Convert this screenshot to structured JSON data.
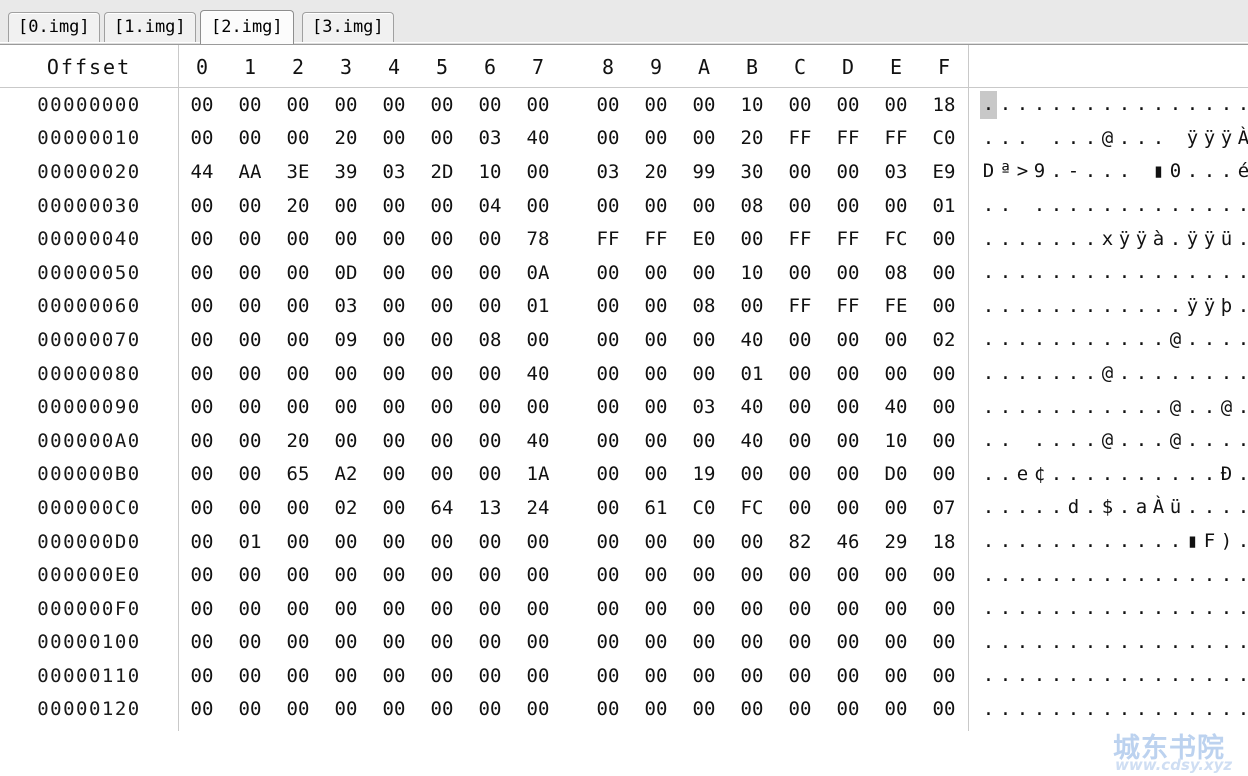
{
  "window": {
    "title": "Hex Editor",
    "background_color": "#ffffff",
    "chrome_color": "#e9e9e9"
  },
  "tabs": {
    "active_index": 2,
    "items": [
      {
        "label": "[0.img]",
        "active": false
      },
      {
        "label": "[1.img]",
        "active": false
      },
      {
        "label": "[2.img]",
        "active": true
      },
      {
        "label": "[3.img]",
        "active": false
      }
    ]
  },
  "header": {
    "offset_label": "Offset",
    "columns": [
      "0",
      "1",
      "2",
      "3",
      "4",
      "5",
      "6",
      "7",
      "8",
      "9",
      "A",
      "B",
      "C",
      "D",
      "E",
      "F"
    ]
  },
  "selection": {
    "row_index": 0,
    "ascii_char_index": 0,
    "highlight_color": "#c8c8c8"
  },
  "watermark": {
    "text_cn": "城东书院",
    "text_url": "www.cdsy.xyz",
    "color_cn": "#bcd2ef",
    "color_url": "#cfdef3"
  },
  "hex_rows": [
    {
      "offset": "00000000",
      "bytes": [
        "00",
        "00",
        "00",
        "00",
        "00",
        "00",
        "00",
        "00",
        "00",
        "00",
        "00",
        "10",
        "00",
        "00",
        "00",
        "18"
      ],
      "ascii": [
        ".",
        ".",
        ".",
        ".",
        ".",
        ".",
        ".",
        ".",
        ".",
        ".",
        ".",
        ".",
        ".",
        ".",
        ".",
        "."
      ]
    },
    {
      "offset": "00000010",
      "bytes": [
        "00",
        "00",
        "00",
        "20",
        "00",
        "00",
        "03",
        "40",
        "00",
        "00",
        "00",
        "20",
        "FF",
        "FF",
        "FF",
        "C0"
      ],
      "ascii": [
        ".",
        ".",
        ".",
        ":sp:",
        ".",
        ".",
        ".",
        "@",
        ".",
        ".",
        ".",
        ":sp:",
        "ÿ",
        "ÿ",
        "ÿ",
        "À"
      ]
    },
    {
      "offset": "00000020",
      "bytes": [
        "44",
        "AA",
        "3E",
        "39",
        "03",
        "2D",
        "10",
        "00",
        "03",
        "20",
        "99",
        "30",
        "00",
        "00",
        "03",
        "E9"
      ],
      "ascii": [
        "D",
        "ª",
        ">",
        "9",
        ".",
        "-",
        ".",
        ".",
        ".",
        ":sp:",
        "▮",
        "0",
        ".",
        ".",
        ".",
        "é"
      ]
    },
    {
      "offset": "00000030",
      "bytes": [
        "00",
        "00",
        "20",
        "00",
        "00",
        "00",
        "04",
        "00",
        "00",
        "00",
        "00",
        "08",
        "00",
        "00",
        "00",
        "01"
      ],
      "ascii": [
        ".",
        ".",
        ":sp:",
        ".",
        ".",
        ".",
        ".",
        ".",
        ".",
        ".",
        ".",
        ".",
        ".",
        ".",
        ".",
        "."
      ]
    },
    {
      "offset": "00000040",
      "bytes": [
        "00",
        "00",
        "00",
        "00",
        "00",
        "00",
        "00",
        "78",
        "FF",
        "FF",
        "E0",
        "00",
        "FF",
        "FF",
        "FC",
        "00"
      ],
      "ascii": [
        ".",
        ".",
        ".",
        ".",
        ".",
        ".",
        ".",
        "x",
        "ÿ",
        "ÿ",
        "à",
        ".",
        "ÿ",
        "ÿ",
        "ü",
        "."
      ]
    },
    {
      "offset": "00000050",
      "bytes": [
        "00",
        "00",
        "00",
        "0D",
        "00",
        "00",
        "00",
        "0A",
        "00",
        "00",
        "00",
        "10",
        "00",
        "00",
        "08",
        "00"
      ],
      "ascii": [
        ".",
        ".",
        ".",
        ".",
        ".",
        ".",
        ".",
        ".",
        ".",
        ".",
        ".",
        ".",
        ".",
        ".",
        ".",
        "."
      ]
    },
    {
      "offset": "00000060",
      "bytes": [
        "00",
        "00",
        "00",
        "03",
        "00",
        "00",
        "00",
        "01",
        "00",
        "00",
        "08",
        "00",
        "FF",
        "FF",
        "FE",
        "00"
      ],
      "ascii": [
        ".",
        ".",
        ".",
        ".",
        ".",
        ".",
        ".",
        ".",
        ".",
        ".",
        ".",
        ".",
        "ÿ",
        "ÿ",
        "þ",
        "."
      ]
    },
    {
      "offset": "00000070",
      "bytes": [
        "00",
        "00",
        "00",
        "09",
        "00",
        "00",
        "08",
        "00",
        "00",
        "00",
        "00",
        "40",
        "00",
        "00",
        "00",
        "02"
      ],
      "ascii": [
        ".",
        ".",
        ".",
        ".",
        ".",
        ".",
        ".",
        ".",
        ".",
        ".",
        ".",
        "@",
        ".",
        ".",
        ".",
        "."
      ]
    },
    {
      "offset": "00000080",
      "bytes": [
        "00",
        "00",
        "00",
        "00",
        "00",
        "00",
        "00",
        "40",
        "00",
        "00",
        "00",
        "01",
        "00",
        "00",
        "00",
        "00"
      ],
      "ascii": [
        ".",
        ".",
        ".",
        ".",
        ".",
        ".",
        ".",
        "@",
        ".",
        ".",
        ".",
        ".",
        ".",
        ".",
        ".",
        "."
      ]
    },
    {
      "offset": "00000090",
      "bytes": [
        "00",
        "00",
        "00",
        "00",
        "00",
        "00",
        "00",
        "00",
        "00",
        "00",
        "03",
        "40",
        "00",
        "00",
        "40",
        "00"
      ],
      "ascii": [
        ".",
        ".",
        ".",
        ".",
        ".",
        ".",
        ".",
        ".",
        ".",
        ".",
        ".",
        "@",
        ".",
        ".",
        "@",
        "."
      ]
    },
    {
      "offset": "000000A0",
      "bytes": [
        "00",
        "00",
        "20",
        "00",
        "00",
        "00",
        "00",
        "40",
        "00",
        "00",
        "00",
        "40",
        "00",
        "00",
        "10",
        "00"
      ],
      "ascii": [
        ".",
        ".",
        ":sp:",
        ".",
        ".",
        ".",
        ".",
        "@",
        ".",
        ".",
        ".",
        "@",
        ".",
        ".",
        ".",
        "."
      ]
    },
    {
      "offset": "000000B0",
      "bytes": [
        "00",
        "00",
        "65",
        "A2",
        "00",
        "00",
        "00",
        "1A",
        "00",
        "00",
        "19",
        "00",
        "00",
        "00",
        "D0",
        "00"
      ],
      "ascii": [
        ".",
        ".",
        "e",
        "¢",
        ".",
        ".",
        ".",
        ".",
        ".",
        ".",
        ".",
        ".",
        ".",
        ".",
        "Ð",
        "."
      ]
    },
    {
      "offset": "000000C0",
      "bytes": [
        "00",
        "00",
        "00",
        "02",
        "00",
        "64",
        "13",
        "24",
        "00",
        "61",
        "C0",
        "FC",
        "00",
        "00",
        "00",
        "07"
      ],
      "ascii": [
        ".",
        ".",
        ".",
        ".",
        ".",
        "d",
        ".",
        "$",
        ".",
        "a",
        "À",
        "ü",
        ".",
        ".",
        ".",
        "."
      ]
    },
    {
      "offset": "000000D0",
      "bytes": [
        "00",
        "01",
        "00",
        "00",
        "00",
        "00",
        "00",
        "00",
        "00",
        "00",
        "00",
        "00",
        "82",
        "46",
        "29",
        "18"
      ],
      "ascii": [
        ".",
        ".",
        ".",
        ".",
        ".",
        ".",
        ".",
        ".",
        ".",
        ".",
        ".",
        ".",
        "▮",
        "F",
        ")",
        "."
      ]
    },
    {
      "offset": "000000E0",
      "bytes": [
        "00",
        "00",
        "00",
        "00",
        "00",
        "00",
        "00",
        "00",
        "00",
        "00",
        "00",
        "00",
        "00",
        "00",
        "00",
        "00"
      ],
      "ascii": [
        ".",
        ".",
        ".",
        ".",
        ".",
        ".",
        ".",
        ".",
        ".",
        ".",
        ".",
        ".",
        ".",
        ".",
        ".",
        "."
      ]
    },
    {
      "offset": "000000F0",
      "bytes": [
        "00",
        "00",
        "00",
        "00",
        "00",
        "00",
        "00",
        "00",
        "00",
        "00",
        "00",
        "00",
        "00",
        "00",
        "00",
        "00"
      ],
      "ascii": [
        ".",
        ".",
        ".",
        ".",
        ".",
        ".",
        ".",
        ".",
        ".",
        ".",
        ".",
        ".",
        ".",
        ".",
        ".",
        "."
      ]
    },
    {
      "offset": "00000100",
      "bytes": [
        "00",
        "00",
        "00",
        "00",
        "00",
        "00",
        "00",
        "00",
        "00",
        "00",
        "00",
        "00",
        "00",
        "00",
        "00",
        "00"
      ],
      "ascii": [
        ".",
        ".",
        ".",
        ".",
        ".",
        ".",
        ".",
        ".",
        ".",
        ".",
        ".",
        ".",
        ".",
        ".",
        ".",
        "."
      ]
    },
    {
      "offset": "00000110",
      "bytes": [
        "00",
        "00",
        "00",
        "00",
        "00",
        "00",
        "00",
        "00",
        "00",
        "00",
        "00",
        "00",
        "00",
        "00",
        "00",
        "00"
      ],
      "ascii": [
        ".",
        ".",
        ".",
        ".",
        ".",
        ".",
        ".",
        ".",
        ".",
        ".",
        ".",
        ".",
        ".",
        ".",
        ".",
        "."
      ]
    },
    {
      "offset": "00000120",
      "bytes": [
        "00",
        "00",
        "00",
        "00",
        "00",
        "00",
        "00",
        "00",
        "00",
        "00",
        "00",
        "00",
        "00",
        "00",
        "00",
        "00"
      ],
      "ascii": [
        ".",
        ".",
        ".",
        ".",
        ".",
        ".",
        ".",
        ".",
        ".",
        ".",
        ".",
        ".",
        ".",
        ".",
        ".",
        "."
      ]
    }
  ]
}
